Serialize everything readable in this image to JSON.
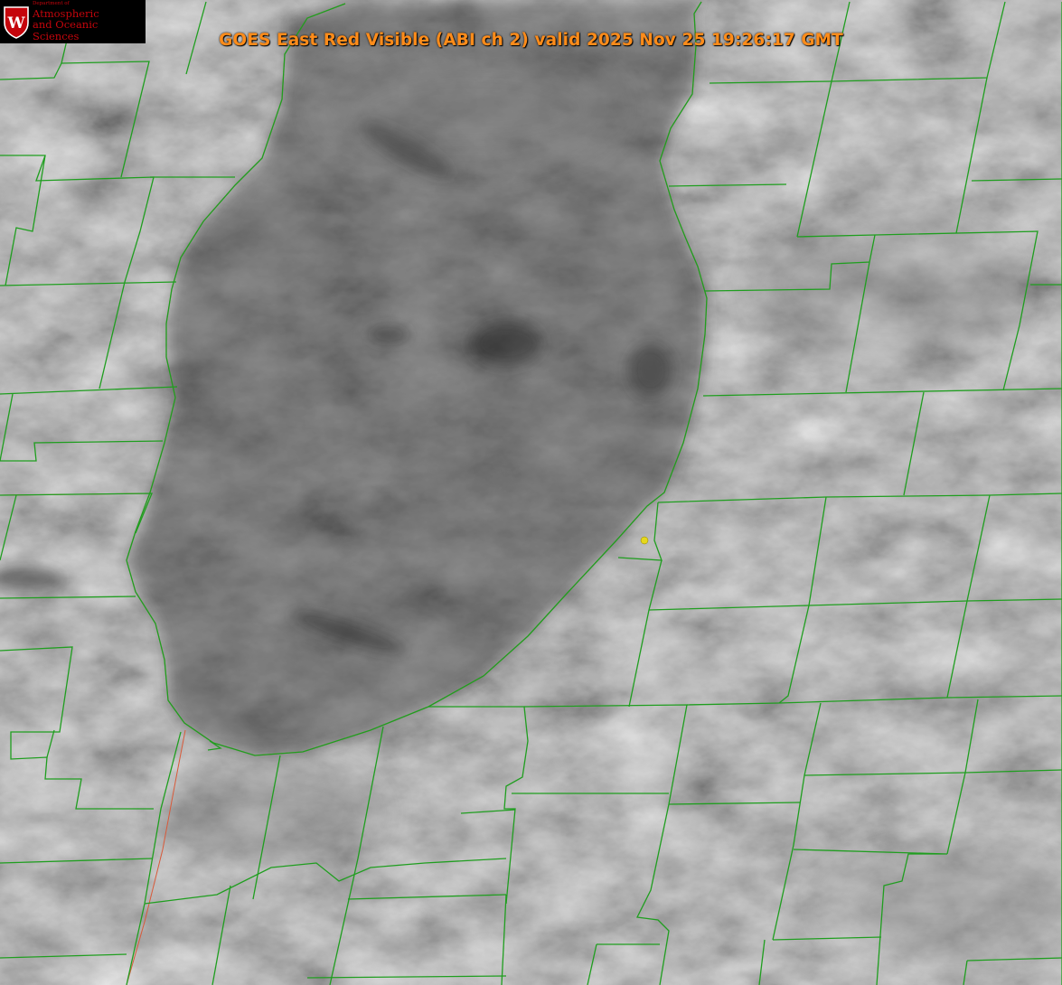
{
  "title": "GOES East Red Visible (ABI ch 2) valid 2025 Nov 25 19:26:17 GMT",
  "logo": {
    "department": "Department of",
    "line1": "Atmospheric",
    "line2": "and Oceanic Sciences",
    "crest_letter": "W"
  },
  "colors": {
    "title": "#ff8c1a",
    "county_lines": "#1f9e1f",
    "state_line": "#d85a3a",
    "marker": "#e6d81c",
    "logo_red": "#c5050c"
  }
}
